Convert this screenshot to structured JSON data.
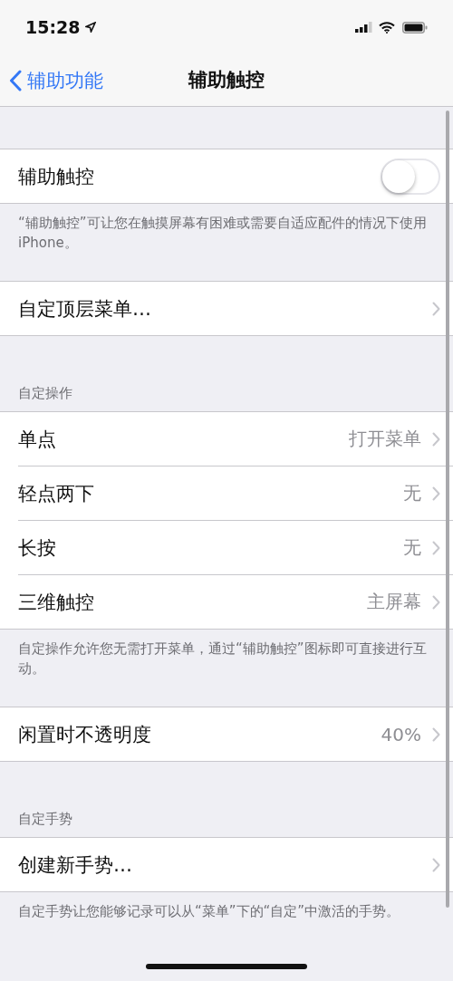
{
  "status_bar": {
    "time": "15:28"
  },
  "nav": {
    "back": "辅助功能",
    "title": "辅助触控"
  },
  "sections": [
    {
      "rows": [
        {
          "kind": "toggle",
          "label": "辅助触控",
          "on": false
        }
      ],
      "footer": "“辅助触控”可让您在触摸屏幕有困难或需要自适应配件的情况下使用 iPhone。"
    },
    {
      "rows": [
        {
          "kind": "link",
          "label": "自定顶层菜单…"
        }
      ]
    },
    {
      "header": "自定操作",
      "rows": [
        {
          "kind": "link",
          "label": "单点",
          "value": "打开菜单"
        },
        {
          "kind": "link",
          "label": "轻点两下",
          "value": "无"
        },
        {
          "kind": "link",
          "label": "长按",
          "value": "无"
        },
        {
          "kind": "link",
          "label": "三维触控",
          "value": "主屏幕"
        }
      ],
      "footer": "自定操作允许您无需打开菜单，通过“辅助触控”图标即可直接进行互动。"
    },
    {
      "rows": [
        {
          "kind": "link",
          "label": "闲置时不透明度",
          "value": "40%"
        }
      ]
    },
    {
      "header": "自定手势",
      "rows": [
        {
          "kind": "link",
          "label": "创建新手势…"
        }
      ],
      "footer": "自定手势让您能够记录可以从“菜单”下的“自定”中激活的手势。"
    }
  ]
}
